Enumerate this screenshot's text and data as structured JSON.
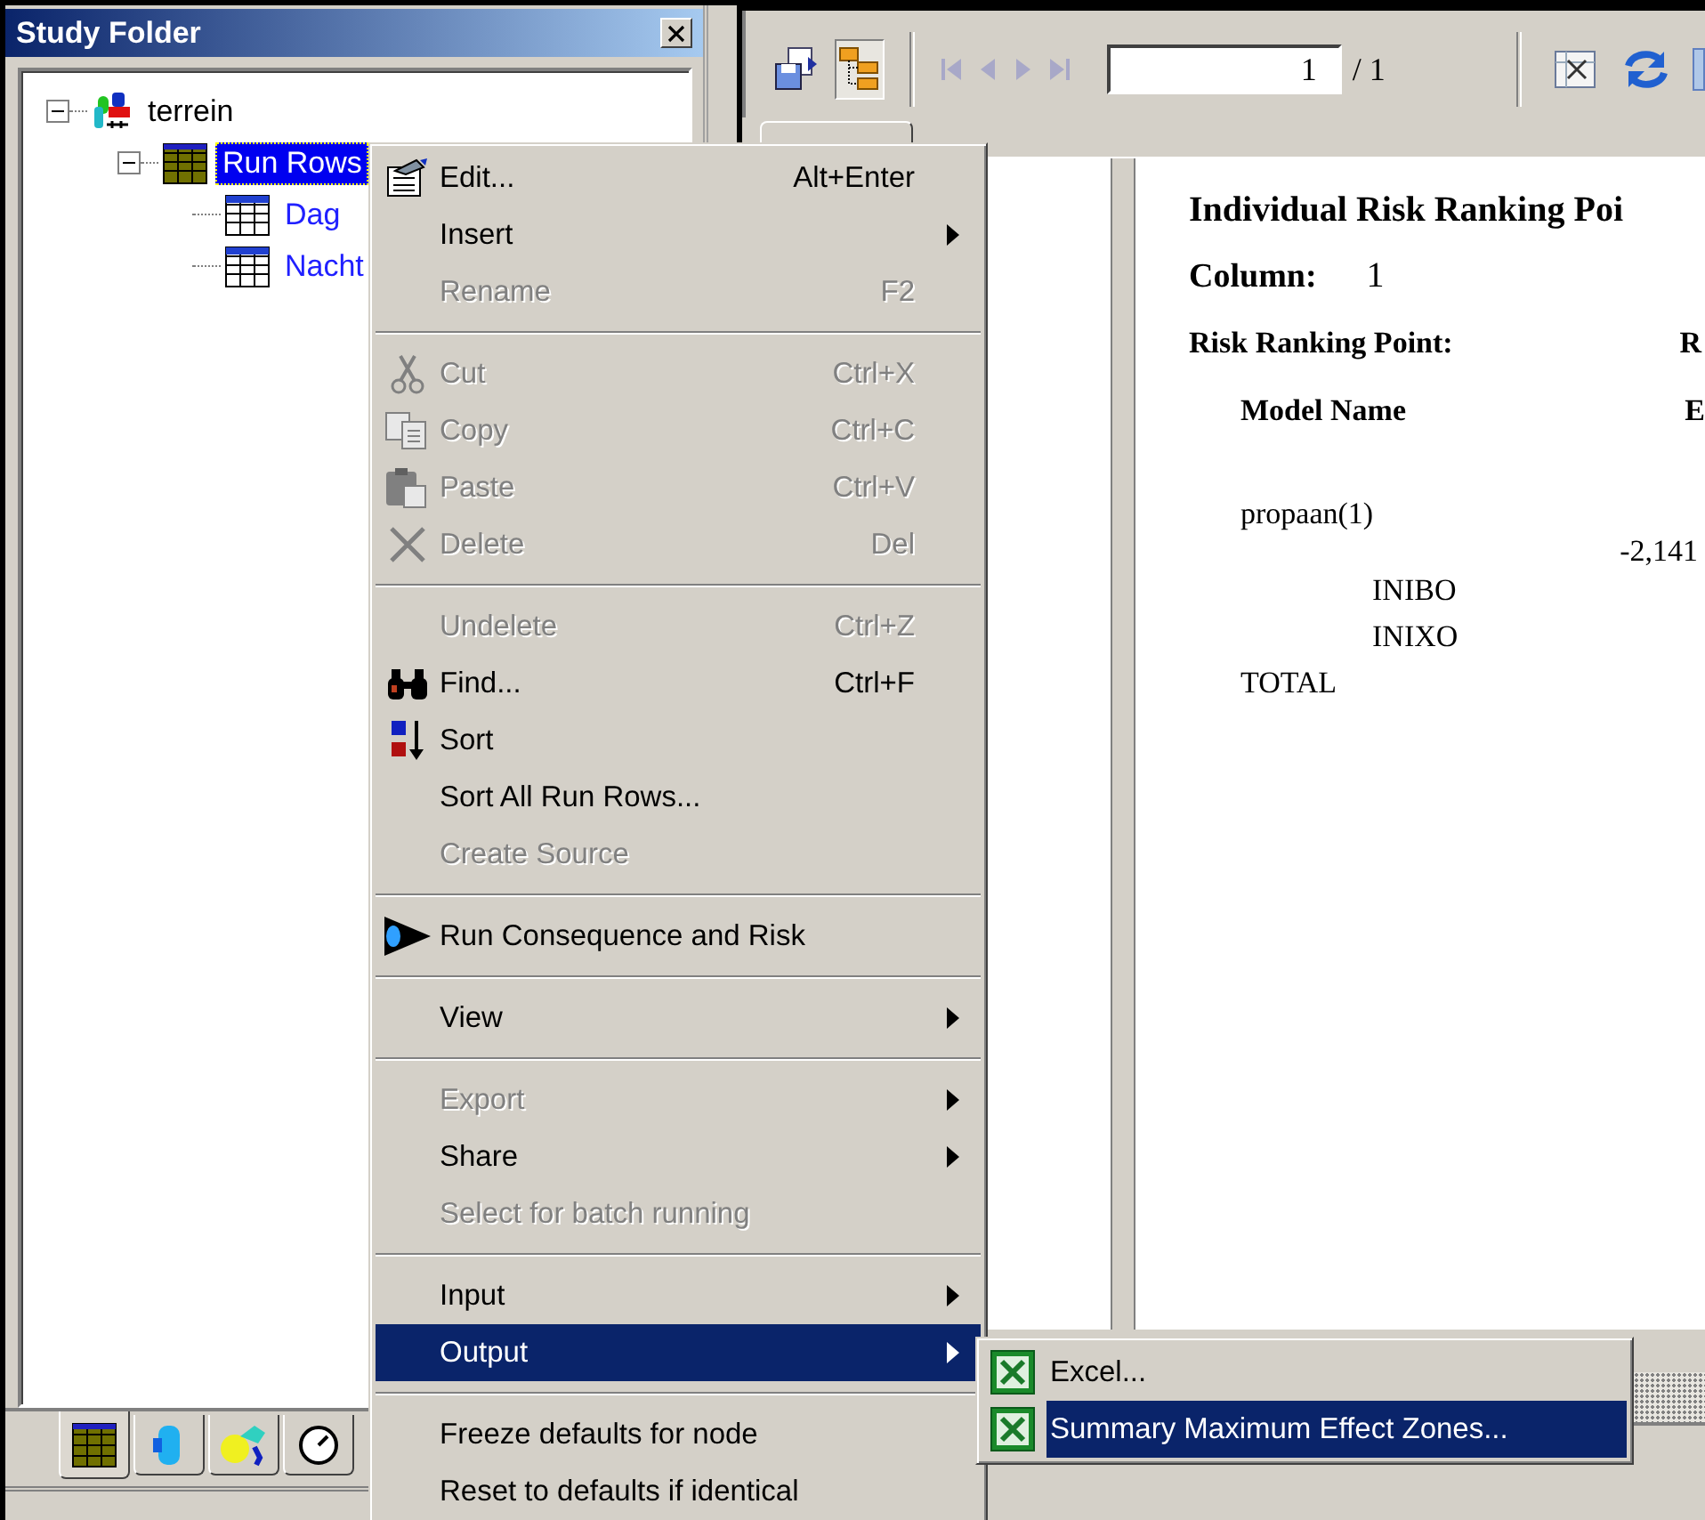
{
  "study_folder": {
    "title": "Study Folder",
    "tree": [
      {
        "label": "terrein",
        "expanded": true,
        "selected": false,
        "children": [
          {
            "label": "Run Rows",
            "expanded": true,
            "selected": true,
            "children": [
              {
                "label": "Dag",
                "selected": false
              },
              {
                "label": "Nacht",
                "selected": false
              }
            ]
          }
        ]
      }
    ],
    "bottom_tabs": [
      {
        "selected": true
      },
      {
        "selected": false
      },
      {
        "selected": false
      },
      {
        "selected": false
      }
    ]
  },
  "toolbar": {
    "page_value": "1",
    "page_total": "/ 1"
  },
  "report": {
    "title": "Individual Risk Ranking Poi",
    "column_label": "Column:",
    "column_value": "1",
    "point_label": "Risk Ranking Point:",
    "point_value": "R",
    "header": "Model Name",
    "header_2": "E",
    "rows": [
      {
        "name": "propaan(1)",
        "value": "-2,141",
        "children": [
          {
            "name": "INIBO"
          },
          {
            "name": "INIXO"
          }
        ]
      },
      {
        "name": "TOTAL"
      }
    ]
  },
  "context_menu": {
    "items": [
      {
        "kind": "item",
        "label": "Edit...",
        "shortcut": "Alt+Enter",
        "disabled": false,
        "selected": false,
        "submenu": false
      },
      {
        "kind": "item",
        "label": "Insert",
        "disabled": false,
        "selected": false,
        "submenu": true
      },
      {
        "kind": "item",
        "label": "Rename",
        "shortcut": "F2",
        "disabled": true,
        "selected": false,
        "submenu": false
      },
      {
        "kind": "separator"
      },
      {
        "kind": "item",
        "label": "Cut",
        "shortcut": "Ctrl+X",
        "disabled": true,
        "selected": false,
        "submenu": false
      },
      {
        "kind": "item",
        "label": "Copy",
        "shortcut": "Ctrl+C",
        "disabled": true,
        "selected": false,
        "submenu": false
      },
      {
        "kind": "item",
        "label": "Paste",
        "shortcut": "Ctrl+V",
        "disabled": true,
        "selected": false,
        "submenu": false
      },
      {
        "kind": "item",
        "label": "Delete",
        "shortcut": "Del",
        "disabled": true,
        "selected": false,
        "submenu": false
      },
      {
        "kind": "separator"
      },
      {
        "kind": "item",
        "label": "Undelete",
        "shortcut": "Ctrl+Z",
        "disabled": true,
        "selected": false,
        "submenu": false
      },
      {
        "kind": "item",
        "label": "Find...",
        "shortcut": "Ctrl+F",
        "disabled": false,
        "selected": false,
        "submenu": false
      },
      {
        "kind": "item",
        "label": "Sort",
        "disabled": false,
        "selected": false,
        "submenu": false
      },
      {
        "kind": "item",
        "label": "Sort All Run Rows...",
        "disabled": false,
        "selected": false,
        "submenu": false
      },
      {
        "kind": "item",
        "label": "Create Source",
        "disabled": true,
        "selected": false,
        "submenu": false
      },
      {
        "kind": "separator"
      },
      {
        "kind": "item",
        "label": "Run Consequence and Risk",
        "disabled": false,
        "selected": false,
        "submenu": false
      },
      {
        "kind": "separator"
      },
      {
        "kind": "item",
        "label": "View",
        "disabled": false,
        "selected": false,
        "submenu": true
      },
      {
        "kind": "separator"
      },
      {
        "kind": "item",
        "label": "Export",
        "disabled": true,
        "selected": false,
        "submenu": true
      },
      {
        "kind": "item",
        "label": "Share",
        "disabled": false,
        "selected": false,
        "submenu": true
      },
      {
        "kind": "item",
        "label": "Select for batch running",
        "disabled": true,
        "selected": false,
        "submenu": false
      },
      {
        "kind": "separator"
      },
      {
        "kind": "item",
        "label": "Input",
        "disabled": false,
        "selected": false,
        "submenu": true
      },
      {
        "kind": "item",
        "label": "Output",
        "disabled": false,
        "selected": true,
        "submenu": true
      },
      {
        "kind": "separator"
      },
      {
        "kind": "item",
        "label": "Freeze defaults for node",
        "disabled": false,
        "selected": false,
        "submenu": false
      },
      {
        "kind": "item",
        "label": "Reset to defaults if identical",
        "disabled": false,
        "selected": false,
        "submenu": false
      }
    ]
  },
  "submenu": {
    "items": [
      {
        "label": "Excel...",
        "selected": false
      },
      {
        "label": "Summary Maximum Effect Zones...",
        "selected": true
      }
    ]
  }
}
